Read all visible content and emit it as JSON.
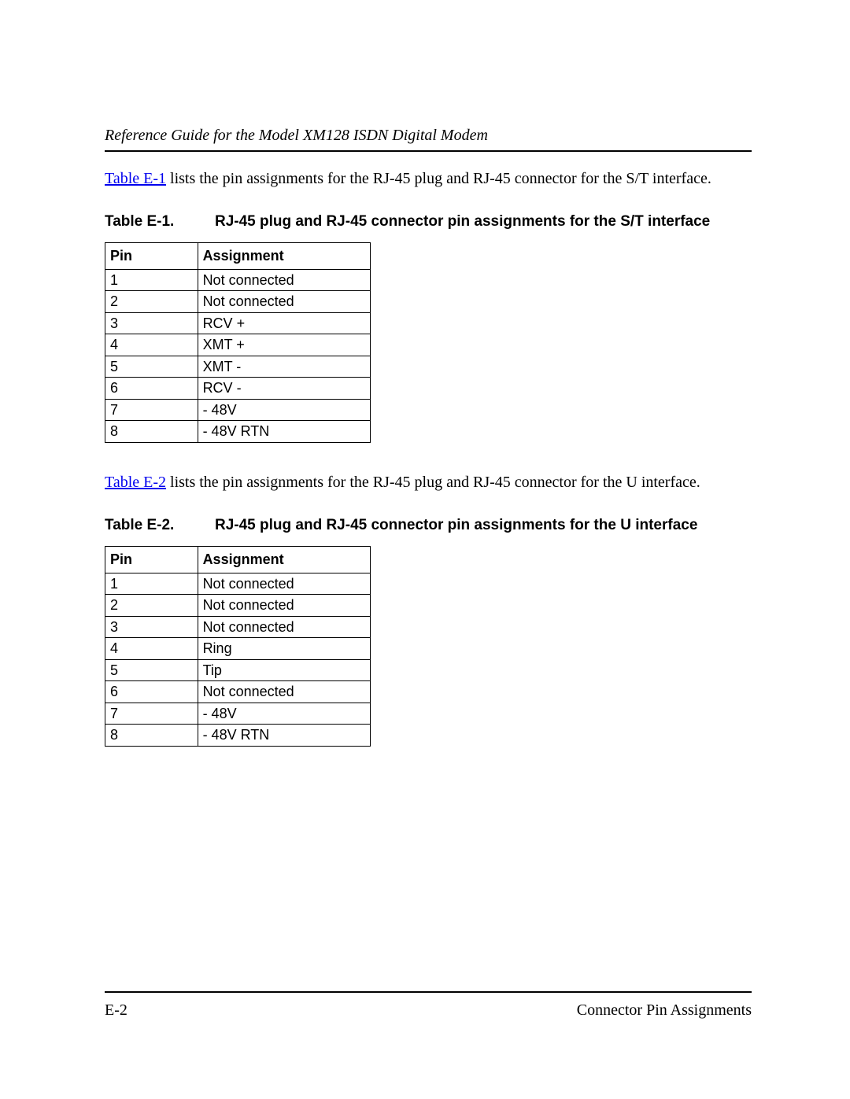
{
  "header": {
    "doc_title": "Reference Guide for the Model XM128 ISDN Digital Modem"
  },
  "para1": {
    "link_text": "Table E-1",
    "rest": " lists the pin assignments for the RJ-45 plug and RJ-45 connector for the S/T interface."
  },
  "table1": {
    "label": "Table E-1.",
    "title": "RJ-45 plug and RJ-45 connector pin assignments for the S/T interface",
    "col_pin": "Pin",
    "col_assign": "Assignment",
    "rows": [
      {
        "pin": "1",
        "assign": "Not connected"
      },
      {
        "pin": "2",
        "assign": "Not connected"
      },
      {
        "pin": "3",
        "assign": "RCV +"
      },
      {
        "pin": "4",
        "assign": "XMT +"
      },
      {
        "pin": "5",
        "assign": "XMT -"
      },
      {
        "pin": "6",
        "assign": "RCV -"
      },
      {
        "pin": "7",
        "assign": "- 48V"
      },
      {
        "pin": "8",
        "assign": "- 48V RTN"
      }
    ]
  },
  "para2": {
    "link_text": "Table E-2",
    "rest": " lists the pin assignments for the RJ-45 plug and RJ-45 connector for the U interface."
  },
  "table2": {
    "label": "Table E-2.",
    "title": "RJ-45 plug and RJ-45 connector pin assignments for the U interface",
    "col_pin": "Pin",
    "col_assign": "Assignment",
    "rows": [
      {
        "pin": "1",
        "assign": "Not connected"
      },
      {
        "pin": "2",
        "assign": "Not connected"
      },
      {
        "pin": "3",
        "assign": "Not connected"
      },
      {
        "pin": "4",
        "assign": "Ring"
      },
      {
        "pin": "5",
        "assign": "Tip"
      },
      {
        "pin": "6",
        "assign": "Not connected"
      },
      {
        "pin": "7",
        "assign": "- 48V"
      },
      {
        "pin": "8",
        "assign": "- 48V RTN"
      }
    ]
  },
  "footer": {
    "page_num": "E-2",
    "section": "Connector Pin Assignments"
  }
}
